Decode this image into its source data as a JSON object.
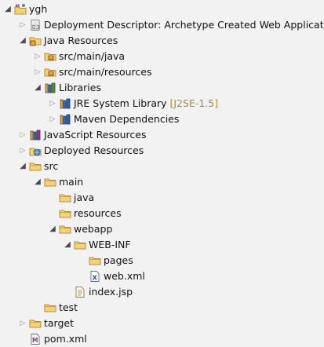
{
  "tree": [
    {
      "label": "ygh",
      "icon": "maven-project-icon",
      "expanded": true,
      "depth": 0
    },
    {
      "label": "Deployment Descriptor: Archetype Created Web Application",
      "icon": "deployment-descriptor-icon",
      "expanded": false,
      "depth": 1
    },
    {
      "label": "Java Resources",
      "icon": "java-resources-icon",
      "expanded": true,
      "depth": 1
    },
    {
      "label": "src/main/java",
      "icon": "source-folder-icon",
      "expanded": false,
      "depth": 2
    },
    {
      "label": "src/main/resources",
      "icon": "source-folder-icon",
      "expanded": false,
      "depth": 2
    },
    {
      "label": "Libraries",
      "icon": "libraries-icon",
      "expanded": true,
      "depth": 2
    },
    {
      "label": "JRE System Library",
      "decoration": "[J2SE-1.5]",
      "icon": "library-icon",
      "expanded": false,
      "depth": 3
    },
    {
      "label": "Maven Dependencies",
      "icon": "library-icon",
      "expanded": false,
      "depth": 3
    },
    {
      "label": "JavaScript Resources",
      "icon": "javascript-resources-icon",
      "expanded": false,
      "depth": 1
    },
    {
      "label": "Deployed Resources",
      "icon": "deployed-resources-icon",
      "expanded": false,
      "depth": 1
    },
    {
      "label": "src",
      "icon": "folder-icon",
      "expanded": true,
      "depth": 1
    },
    {
      "label": "main",
      "icon": "folder-icon",
      "expanded": true,
      "depth": 2
    },
    {
      "label": "java",
      "icon": "folder-icon",
      "expanded": null,
      "depth": 3
    },
    {
      "label": "resources",
      "icon": "folder-icon",
      "expanded": null,
      "depth": 3
    },
    {
      "label": "webapp",
      "icon": "folder-icon",
      "expanded": true,
      "depth": 3
    },
    {
      "label": "WEB-INF",
      "icon": "folder-icon",
      "expanded": true,
      "depth": 4
    },
    {
      "label": "pages",
      "icon": "folder-icon",
      "expanded": null,
      "depth": 5
    },
    {
      "label": "web.xml",
      "icon": "xml-file-icon",
      "expanded": null,
      "depth": 5
    },
    {
      "label": "index.jsp",
      "icon": "jsp-file-icon",
      "expanded": null,
      "depth": 4
    },
    {
      "label": "test",
      "icon": "folder-icon",
      "expanded": null,
      "depth": 2
    },
    {
      "label": "target",
      "icon": "folder-icon",
      "expanded": false,
      "depth": 1
    },
    {
      "label": "pom.xml",
      "icon": "pom-file-icon",
      "expanded": null,
      "depth": 1
    }
  ],
  "colors": {
    "background": "#f2f2f2",
    "decoration": "#a68a3c",
    "folder": "#e8c36a",
    "book_blue": "#2f5fa8"
  }
}
